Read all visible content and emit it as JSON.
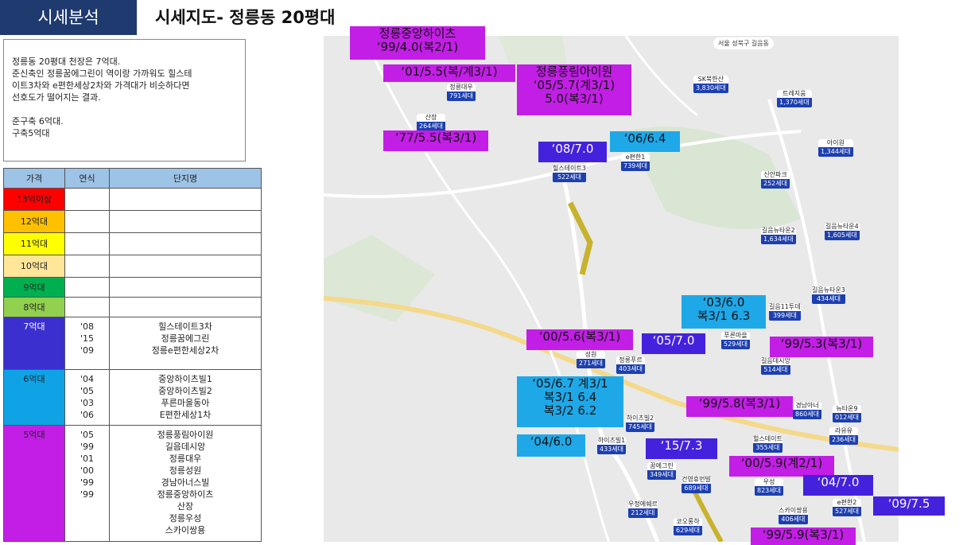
{
  "header": {
    "section": "시세분석",
    "title": "시세지도- 정릉동 20평대"
  },
  "note": {
    "lines": [
      "정릉동 20평대 천장은 7억대.",
      "준신축인 정릉꿈에그린이 역이랑 가까워도 힐스테",
      "이트3차와 e편한세상2차와 가격대가 비슷하다면",
      "선호도가 떨어지는 결과."
    ],
    "lines2": [
      "준구축 6억대.",
      "구축5억대"
    ]
  },
  "legend": {
    "headers": [
      "가격",
      "연식",
      "단지명"
    ],
    "rows": [
      {
        "price": "13억이상",
        "color": "#ff0000",
        "years": "",
        "names": ""
      },
      {
        "price": "12억대",
        "color": "#ffc000",
        "years": "",
        "names": ""
      },
      {
        "price": "11억대",
        "color": "#ffff00",
        "years": "",
        "names": ""
      },
      {
        "price": "10억대",
        "color": "#ffe699",
        "years": "",
        "names": ""
      },
      {
        "price": "9억대",
        "color": "#00b050",
        "years": "",
        "names": ""
      },
      {
        "price": "8억대",
        "color": "#92d050",
        "years": "",
        "names": ""
      },
      {
        "price": "7억대",
        "color": "#3b2fcf",
        "years": "'08\n'15\n'09",
        "names": "힐스테이트3차\n정릉꿈에그린\n정릉e편한세상2차"
      },
      {
        "price": "6억대",
        "color": "#0fa3e6",
        "years": "'04\n'05\n'03\n'06",
        "names": "중앙하이츠빌1\n중앙하이츠빌2\n푸른마을동아\nE편한세상1차"
      },
      {
        "price": "5억대",
        "color": "#c21ee6",
        "years": "'05\n'99\n'01\n'00\n'99\n'99",
        "names": "정릉풍림아이원\n길음데시앙\n정릉대우\n정릉성원\n경남아너스빌\n정릉중앙하이츠\n산장\n정릉우성\n스카이쌍용"
      }
    ]
  },
  "map": {
    "topbar": "서울  성북구  길음동",
    "markers": [
      {
        "name": "정릉대우",
        "count": "791세대"
      },
      {
        "name": "산장",
        "count": "264세대"
      },
      {
        "name": "힐스테이트3",
        "count": "522세대"
      },
      {
        "name": "e편한1",
        "count": "739세대"
      },
      {
        "name": "SK북한산",
        "count": "3,830세대"
      },
      {
        "name": "트레지움",
        "count": "1,370세대"
      },
      {
        "name": "아이원",
        "count": "1,344세대"
      },
      {
        "name": "신안파크",
        "count": "252세대"
      },
      {
        "name": "길음뉴타운2",
        "count": "1,634세대"
      },
      {
        "name": "길음뉴타운4",
        "count": "1,605세대"
      },
      {
        "name": "길음뉴타운3",
        "count": "434세대"
      },
      {
        "name": "길음11투데",
        "count": "399세대"
      },
      {
        "name": "푸른마을",
        "count": "529세대"
      },
      {
        "name": "길음데시앙",
        "count": "514세대"
      },
      {
        "name": "성원",
        "count": "271세대"
      },
      {
        "name": "정릉푸르",
        "count": "403세대"
      },
      {
        "name": "하이츠빌2",
        "count": "745세대"
      },
      {
        "name": "경남아너",
        "count": "860세대"
      },
      {
        "name": "뉴타운9",
        "count": "012세대"
      },
      {
        "name": "라유유",
        "count": "236세대"
      },
      {
        "name": "하이츠빌1",
        "count": "433세대"
      },
      {
        "name": "힐스테이트",
        "count": "355세대"
      },
      {
        "name": "꿈에그린",
        "count": "349세대"
      },
      {
        "name": "건영휴먼빌",
        "count": "689세대"
      },
      {
        "name": "우성",
        "count": "823세대"
      },
      {
        "name": "우정에쉐르",
        "count": "212세대"
      },
      {
        "name": "스카이쌍용",
        "count": "406세대"
      },
      {
        "name": "e편한2",
        "count": "527세대"
      },
      {
        "name": "코오롱하",
        "count": "629세대"
      }
    ],
    "labels": [
      {
        "lines": [
          "정릉중앙하이츠",
          "‘99/4.0(복2/1)"
        ],
        "kind": "purple"
      },
      {
        "lines": [
          "‘01/5.5(복/계3/1)"
        ],
        "kind": "purple"
      },
      {
        "lines": [
          "정릉풍림아이원",
          "‘05/5.7(계3/1)",
          "5.0(복3/1)"
        ],
        "kind": "purple"
      },
      {
        "lines": [
          "‘77/5.5(복3/1)"
        ],
        "kind": "purple"
      },
      {
        "lines": [
          "‘08/7.0"
        ],
        "kind": "dblue"
      },
      {
        "lines": [
          "‘06/6.4"
        ],
        "kind": "blue"
      },
      {
        "lines": [
          "‘03/6.0",
          "복3/1 6.3"
        ],
        "kind": "blue"
      },
      {
        "lines": [
          "‘00/5.6(복3/1)"
        ],
        "kind": "purple"
      },
      {
        "lines": [
          "‘05/7.0"
        ],
        "kind": "dblue"
      },
      {
        "lines": [
          "‘99/5.3(복3/1)"
        ],
        "kind": "purple"
      },
      {
        "lines": [
          "‘05/6.7 계3/1",
          "복3/1 6.4",
          "복3/2 6.2"
        ],
        "kind": "blue"
      },
      {
        "lines": [
          "‘99/5.8(복3/1)"
        ],
        "kind": "purple"
      },
      {
        "lines": [
          "‘04/6.0"
        ],
        "kind": "blue"
      },
      {
        "lines": [
          "‘15/7.3"
        ],
        "kind": "dblue"
      },
      {
        "lines": [
          "‘00/5.9(계2/1)"
        ],
        "kind": "purple"
      },
      {
        "lines": [
          "‘04/7.0"
        ],
        "kind": "dblue"
      },
      {
        "lines": [
          "‘09/7.5"
        ],
        "kind": "dblue"
      },
      {
        "lines": [
          "‘99/5.9(복3/1)"
        ],
        "kind": "purple"
      }
    ]
  }
}
